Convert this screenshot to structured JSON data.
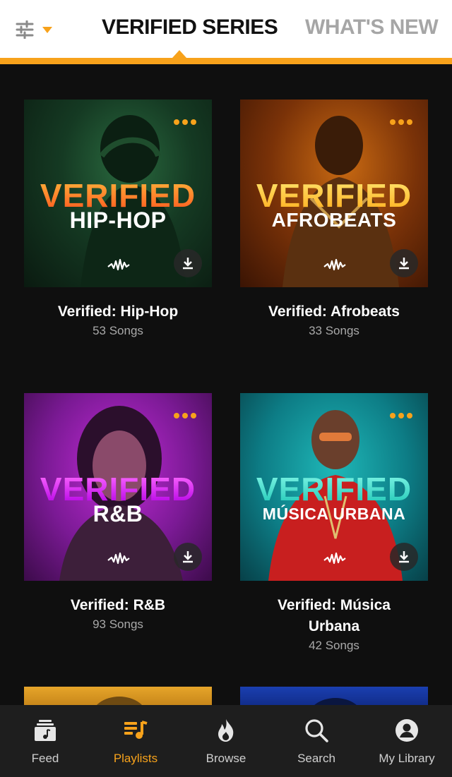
{
  "header": {
    "tabs": [
      {
        "label": "VERIFIED SERIES",
        "active": true
      },
      {
        "label": "WHAT'S NEW",
        "active": false
      }
    ],
    "filter_icon": "sliders-icon",
    "accent_color": "#f7a21b"
  },
  "playlists": [
    {
      "title": "Verified: Hip-Hop",
      "count": "53 Songs",
      "cover_brand": "VERIFIED",
      "cover_genre": "HIP-HOP"
    },
    {
      "title": "Verified: Afrobeats",
      "count": "33 Songs",
      "cover_brand": "VERIFIED",
      "cover_genre": "AFROBEATS"
    },
    {
      "title": "Verified: R&B",
      "count": "93 Songs",
      "cover_brand": "VERIFIED",
      "cover_genre": "R&B"
    },
    {
      "title": "Verified: Música Urbana",
      "count": "42 Songs",
      "cover_brand": "VERIFIED",
      "cover_genre": "MÚSICA URBANA"
    }
  ],
  "bottom_nav": [
    {
      "label": "Feed",
      "icon": "music-note-stack-icon",
      "active": false
    },
    {
      "label": "Playlists",
      "icon": "playlist-icon",
      "active": true
    },
    {
      "label": "Browse",
      "icon": "flame-icon",
      "active": false
    },
    {
      "label": "Search",
      "icon": "search-icon",
      "active": false
    },
    {
      "label": "My Library",
      "icon": "user-circle-icon",
      "active": false
    }
  ]
}
